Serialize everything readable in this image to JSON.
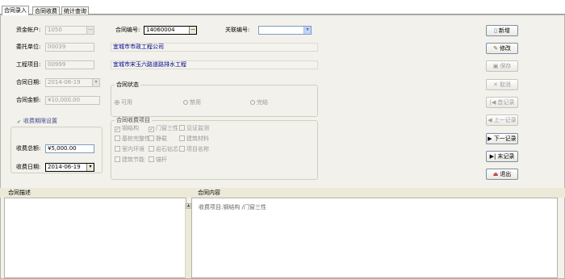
{
  "tabs": [
    {
      "label": "合同录入",
      "active": true
    },
    {
      "label": "合同收费",
      "active": false
    },
    {
      "label": "统计查询",
      "active": false
    }
  ],
  "left": {
    "fund_account": {
      "label": "资金帐户:",
      "value": "1050"
    },
    "client_unit": {
      "label": "委托单位:",
      "value": "00039"
    },
    "project": {
      "label": "工程项目:",
      "value": "00999"
    },
    "contract_date": {
      "label": "合同日期:",
      "value": "2014-06-19"
    },
    "contract_amount": {
      "label": "合同金额:",
      "value": "¥10,000.00"
    },
    "fee_period_setting": "收费期限设置",
    "fee_total": {
      "label": "收费总额:",
      "value": "¥5,000.00"
    },
    "fee_date": {
      "label": "收费日期:",
      "value": "2014-06-19"
    }
  },
  "middle": {
    "contract_no": {
      "label": "合同编号:",
      "value": "14060004"
    },
    "related_no": {
      "label": "关联编号:",
      "value": ""
    },
    "client_name": "宜城市市政工程公司",
    "project_name": "宜城市宋玉六路道路排水工程",
    "status": {
      "title": "合同状态",
      "options": [
        {
          "label": "可用",
          "selected": true
        },
        {
          "label": "禁用",
          "selected": false
        },
        {
          "label": "完结",
          "selected": false
        }
      ]
    },
    "fee_items": {
      "title": "合同收费项目",
      "items": [
        {
          "label": "钢结构",
          "checked": true
        },
        {
          "label": "门窗三性",
          "checked": true
        },
        {
          "label": "见证监测",
          "checked": false
        },
        {
          "label": "基桩完整性",
          "checked": false
        },
        {
          "label": "静载",
          "checked": false
        },
        {
          "label": "建筑材料",
          "checked": false
        },
        {
          "label": "室内环境",
          "checked": false
        },
        {
          "label": "岩石钻芯",
          "checked": false
        },
        {
          "label": "项目名称",
          "checked": false
        },
        {
          "label": "建筑节能",
          "checked": false
        },
        {
          "label": "锚杆",
          "checked": false
        }
      ]
    }
  },
  "buttons": [
    {
      "label": "新增",
      "icon": "new-doc-icon",
      "glyph": "▯",
      "enabled": true
    },
    {
      "label": "修改",
      "icon": "edit-icon",
      "glyph": "✎",
      "enabled": true
    },
    {
      "label": "保存",
      "icon": "save-icon",
      "glyph": "▣",
      "enabled": false
    },
    {
      "label": "取消",
      "icon": "cancel-icon",
      "glyph": "✕",
      "enabled": false
    },
    {
      "label": "首记录",
      "icon": "first-record-icon",
      "glyph": "|◀",
      "enabled": false
    },
    {
      "label": "上一记录",
      "icon": "prev-record-icon",
      "glyph": "◀",
      "enabled": false
    },
    {
      "label": "下一记录",
      "icon": "next-record-icon",
      "glyph": "▶",
      "enabled": true
    },
    {
      "label": "末记录",
      "icon": "last-record-icon",
      "glyph": "▶|",
      "enabled": true
    },
    {
      "label": "退出",
      "icon": "exit-icon",
      "glyph": "⏏",
      "enabled": true
    }
  ],
  "bottom": {
    "desc_header": "合同描述",
    "content_header": "合同内容",
    "content_text": "收费项目:钢结构 /门窗三性"
  }
}
